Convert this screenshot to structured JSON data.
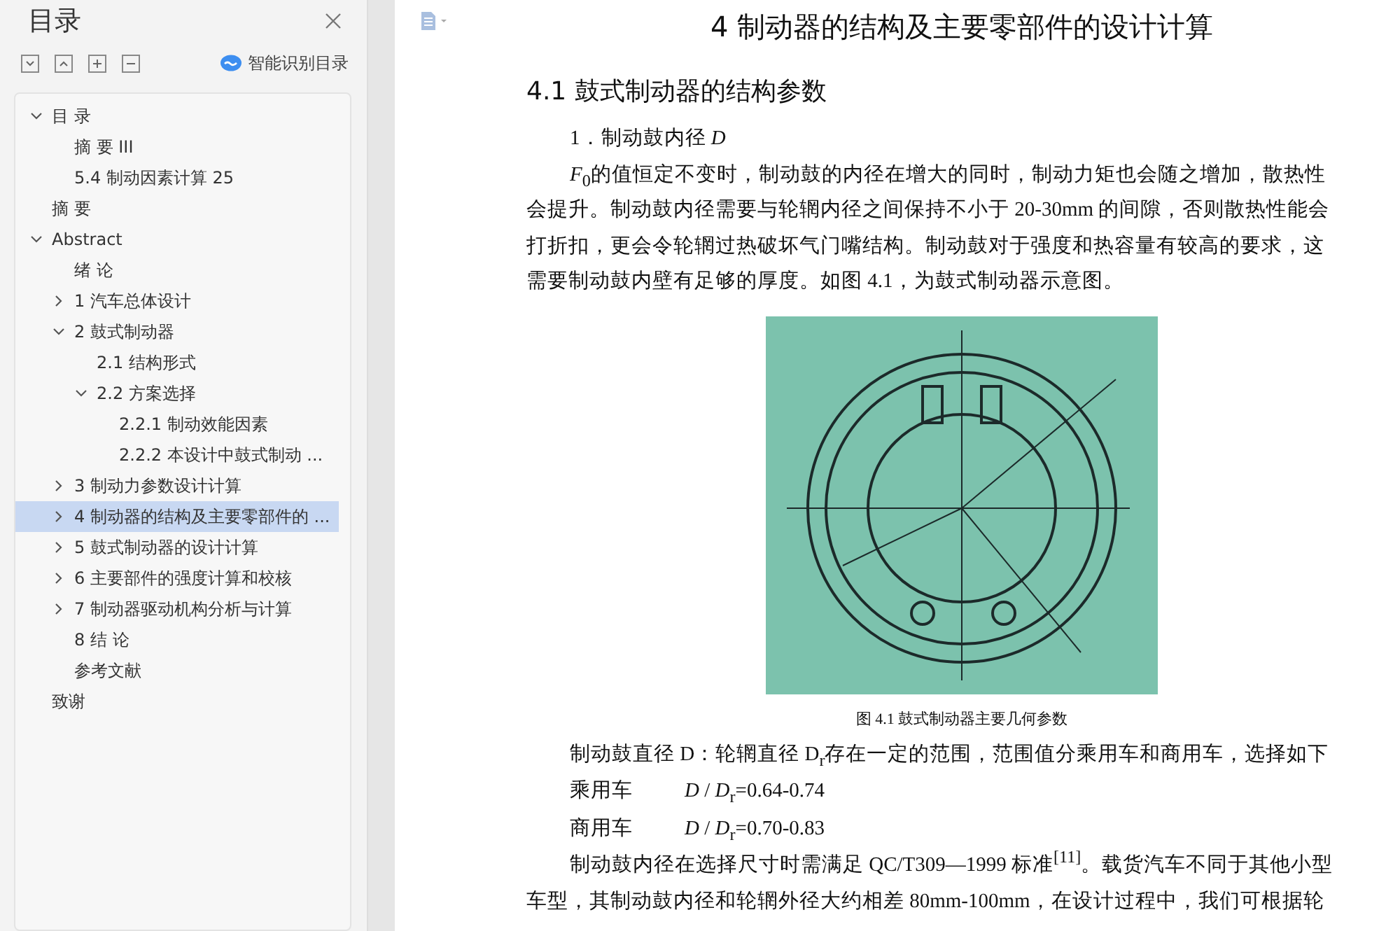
{
  "sidebar": {
    "title": "目录",
    "smart_button": "智能识别目录",
    "tree": [
      {
        "label": "目 录",
        "expanded": true,
        "selected": false,
        "children": [
          {
            "label": "摘 要 III",
            "selected": false
          },
          {
            "label": "5.4 制动因素计算  25",
            "selected": false
          }
        ]
      },
      {
        "label": "摘 要",
        "selected": false
      },
      {
        "label": "Abstract",
        "expanded": true,
        "selected": false,
        "children": [
          {
            "label": "绪 论",
            "selected": false
          },
          {
            "label": "1  汽车总体设计",
            "expanded": false,
            "selected": false
          },
          {
            "label": "2  鼓式制动器",
            "expanded": true,
            "selected": false,
            "children": [
              {
                "label": "2.1 结构形式",
                "selected": false
              },
              {
                "label": "2.2 方案选择",
                "expanded": true,
                "selected": false,
                "children": [
                  {
                    "label": "2.2.1 制动效能因素",
                    "selected": false
                  },
                  {
                    "label": "2.2.2 本设计中鼓式制动 ...",
                    "selected": false
                  }
                ]
              }
            ]
          },
          {
            "label": "3 制动力参数设计计算",
            "expanded": false,
            "selected": false
          },
          {
            "label": "4 制动器的结构及主要零部件的 ...",
            "expanded": false,
            "selected": true
          },
          {
            "label": "5  鼓式制动器的设计计算",
            "expanded": false,
            "selected": false
          },
          {
            "label": "6  主要部件的强度计算和校核",
            "expanded": false,
            "selected": false
          },
          {
            "label": "7  制动器驱动机构分析与计算",
            "expanded": false,
            "selected": false
          },
          {
            "label": "8  结 论",
            "selected": false
          },
          {
            "label": "参考文献",
            "selected": false
          }
        ]
      },
      {
        "label": "致谢",
        "selected": false
      }
    ]
  },
  "document": {
    "blocks": [
      {
        "kind": "chapter",
        "text": "4  制动器的结构及主要零部件的设计计算"
      },
      {
        "kind": "section",
        "text": "4.1  鼓式制动器的结构参数"
      },
      {
        "kind": "paragraph",
        "lines": [
          "1．制动鼓内径 *D*"
        ]
      },
      {
        "kind": "paragraph",
        "lines": [
          "*F*$_{0}$的值恒定不变时，制动鼓的内径在增大的同时，制动力矩也会随之增加，散热性",
          "会提升。制动鼓内径需要与轮辋内径之间保持不小于 20-30mm 的间隙，否则散热性能会",
          "打折扣，更会令轮辋过热破坏气门嘴结构。制动鼓对于强度和热容量有较高的要求，这",
          "需要制动鼓内壁有足够的厚度。如图 4.1，为鼓式制动器示意图。"
        ]
      },
      {
        "kind": "figure",
        "caption": "图 4.1 鼓式制动器主要几何参数"
      },
      {
        "kind": "paragraph",
        "lines": [
          "制动鼓直径 D：轮辋直径 D$_{r}$存在一定的范围，范围值分乘用车和商用车，选择如下"
        ]
      },
      {
        "kind": "ratio",
        "label": "乘用车",
        "text": "*D* / *D*$_{r}$=0.64-0.74"
      },
      {
        "kind": "ratio",
        "label": "商用车",
        "text": "*D* / *D*$_{r}$=0.70-0.83"
      },
      {
        "kind": "paragraph",
        "lines": [
          "制动鼓内径在选择尺寸时需满足 QC/T309—1999 标准$^{[11]}$。载货汽车不同于其他小型",
          "车型，其制动鼓内径和轮辋外径大约相差 80mm-100mm，在设计过程中，我们可根据轮"
        ]
      }
    ]
  }
}
